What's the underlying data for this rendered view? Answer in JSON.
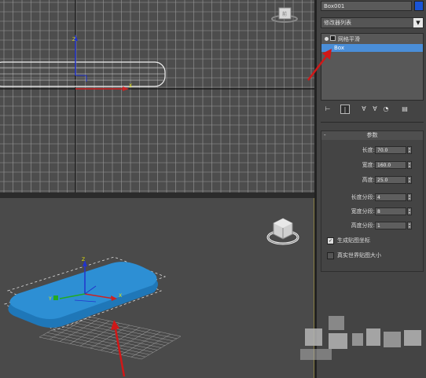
{
  "panel": {
    "object_name": "Box001",
    "object_color": "#1a54d6",
    "modifier_list_label": "修改器列表",
    "modifier_list_arrow": "▼",
    "stack": [
      {
        "label": "网格平滑"
      },
      {
        "label": "Box"
      }
    ],
    "params_title": "参数",
    "params_collapse": "-",
    "params": [
      {
        "label": "长度:",
        "value": "70.0"
      },
      {
        "label": "宽度:",
        "value": "160.0"
      },
      {
        "label": "高度:",
        "value": "25.0"
      },
      {
        "label": "长度分段:",
        "value": "4"
      },
      {
        "label": "宽度分段:",
        "value": "8"
      },
      {
        "label": "高度分段:",
        "value": "1"
      }
    ],
    "checkboxes": [
      {
        "label": "生成贴图坐标",
        "checked": true,
        "mark": "✓"
      },
      {
        "label": "真实世界贴图大小",
        "checked": false,
        "mark": ""
      }
    ]
  },
  "viewport": {
    "viewcube_label": "前",
    "gizmo_x_label": "X",
    "gizmo_y_label": "Y",
    "gizmo_z_label": "Z",
    "box_color": "#2d8fd4",
    "annotation_color": "#d01818"
  }
}
